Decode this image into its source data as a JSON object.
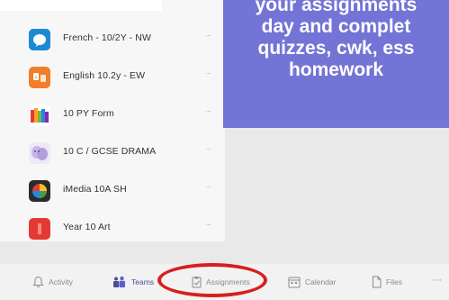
{
  "teams": [
    {
      "label": "French - 10/2Y - NW",
      "more": "···",
      "icon": "french-team-icon",
      "color": "#1e8ad4"
    },
    {
      "label": "English 10.2y - EW",
      "more": "···",
      "icon": "english-team-icon",
      "color": "#f07e2a"
    },
    {
      "label": "10 PY Form",
      "more": "···",
      "icon": "form-team-icon",
      "color": "#d2264a"
    },
    {
      "label": "10 C / GCSE DRAMA",
      "more": "···",
      "icon": "drama-team-icon",
      "color": "#c9b8e6"
    },
    {
      "label": "iMedia 10A SH",
      "more": "···",
      "icon": "imedia-team-icon",
      "color": "#2b2b2b"
    },
    {
      "label": "Year 10 Art",
      "more": "···",
      "icon": "art-team-icon",
      "color": "#e53935"
    }
  ],
  "callout": {
    "lines": [
      "your assignments",
      "day and complet",
      "quizzes, cwk, ess",
      "homework"
    ],
    "background": "#7374d6"
  },
  "nav": {
    "activity": "Activity",
    "teams": "Teams",
    "assignments": "Assignments",
    "calendar": "Calendar",
    "files": "Files",
    "more": "···"
  },
  "highlight_color": "#d81e1e"
}
